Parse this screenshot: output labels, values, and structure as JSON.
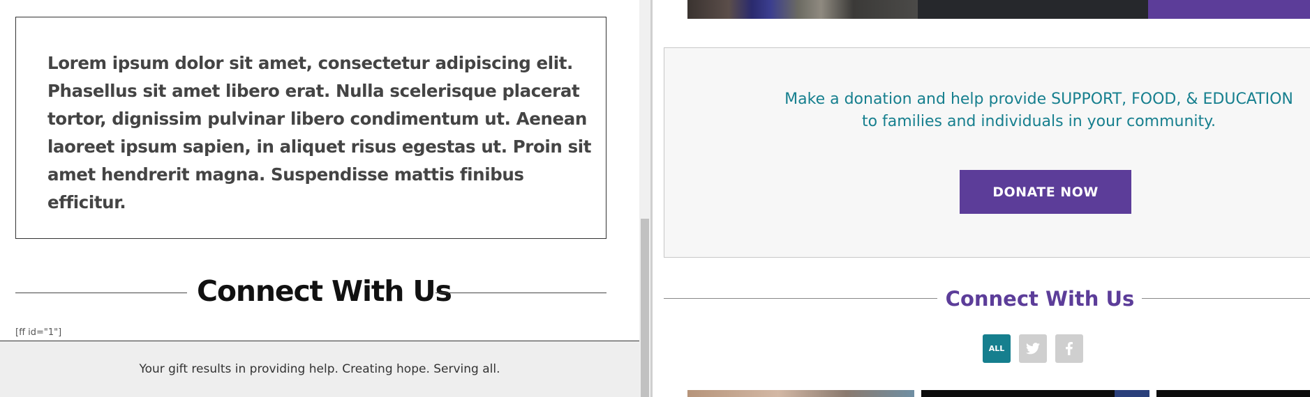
{
  "left": {
    "body_text": "Lorem ipsum dolor sit amet, consectetur adipiscing elit. Phasellus sit amet libero erat. Nulla scelerisque placerat tortor, dignissim pulvinar libero condimentum ut. Aenean laoreet ipsum sapien, in aliquet risus egestas ut. Proin sit amet hendrerit magna. Suspendisse mattis finibus efficitur.",
    "connect_heading": "Connect With Us",
    "shortcode": "[ff id=\"1\"]",
    "footer_tagline": "Your gift results in providing help. Creating hope. Serving all."
  },
  "right": {
    "donate_line_1": "Make a donation and help provide SUPPORT, FOOD, & EDUCATION",
    "donate_line_2": "to families and individuals in your community.",
    "donate_button": "DONATE NOW",
    "connect_heading": "Connect With Us",
    "social_filters": [
      {
        "label": "ALL",
        "icon": "all-filter",
        "active": true
      },
      {
        "label": "",
        "icon": "twitter-icon",
        "active": false
      },
      {
        "label": "",
        "icon": "facebook-icon",
        "active": false
      }
    ]
  },
  "colors": {
    "accent_purple": "#5c3d99",
    "accent_teal": "#167f8e",
    "footer_bg": "#eeeeee"
  }
}
